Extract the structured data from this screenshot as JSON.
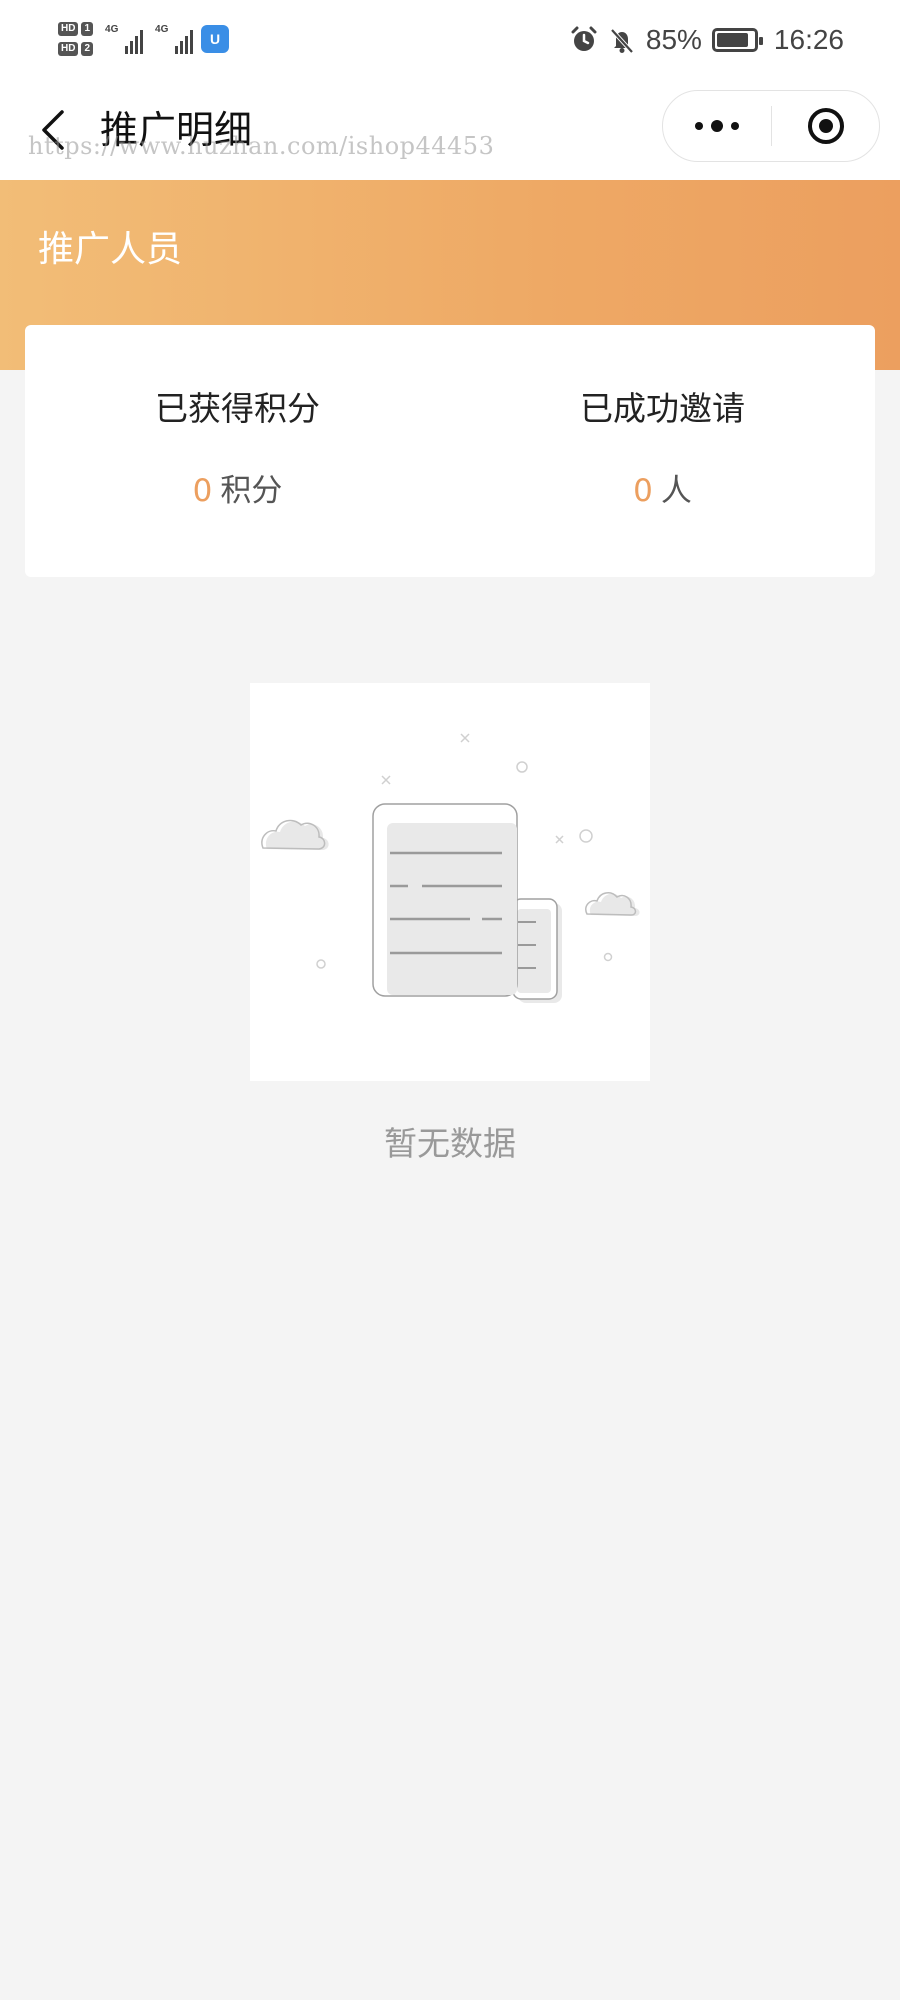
{
  "status_bar": {
    "sim1_label": "HD",
    "sim1_num": "1",
    "sim2_label": "HD",
    "sim2_num": "2",
    "network1": "4G",
    "network2": "4G",
    "app_badge": "U",
    "battery_percent": "85%",
    "battery_level": 0.85,
    "time": "16:26",
    "icons": [
      "alarm-icon",
      "mute-bell-icon",
      "battery-icon"
    ]
  },
  "nav": {
    "title": "推广明细",
    "watermark": "https://www.huzhan.com/ishop44453",
    "back_icon": "chevron-left-icon",
    "more_icon": "more-dots-icon",
    "close_icon": "target-circle-icon"
  },
  "banner": {
    "title": "推广人员"
  },
  "stats": {
    "points": {
      "label": "已获得积分",
      "value": "0",
      "unit": "积分"
    },
    "invites": {
      "label": "已成功邀请",
      "value": "0",
      "unit": "人"
    }
  },
  "empty": {
    "text": "暂无数据",
    "illustration": "empty-document-illustration"
  },
  "colors": {
    "accent": "#ec9f5f",
    "banner_start": "#f2bd77",
    "banner_end": "#ec9f5f",
    "background": "#f4f4f4"
  }
}
